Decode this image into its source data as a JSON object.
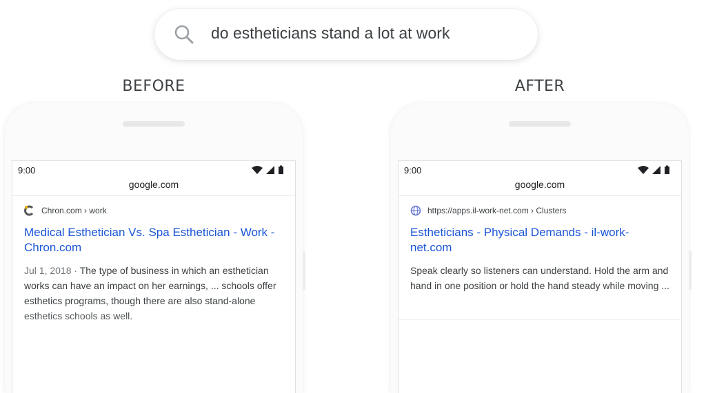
{
  "search": {
    "query": "do estheticians stand a lot at work",
    "icon": "search-icon"
  },
  "before": {
    "caption": "BEFORE",
    "status_time": "9:00",
    "url": "google.com",
    "result": {
      "site": "Chron.com › work",
      "favicon": "chron-favicon-icon",
      "title": "Medical Esthetician Vs. Spa Esthetician - Work - Chron.com",
      "date": "Jul 1, 2018 · ",
      "snippet": "The type of business in which an esthetician works can have an impact on her earnings, ... schools offer esthetics programs, though there are also stand-alone esthetics schools as well."
    }
  },
  "after": {
    "caption": "AFTER",
    "status_time": "9:00",
    "url": "google.com",
    "result": {
      "site": "https://apps.il-work-net.com › Clusters",
      "favicon": "globe-icon",
      "title": "Estheticians - Physical Demands - il-work-net.com",
      "snippet": "Speak clearly so listeners can understand. Hold the arm and hand in one position or hold the hand steady while moving ..."
    }
  },
  "colors": {
    "link": "#1a55d6",
    "text": "#3c4043",
    "muted": "#70757a"
  }
}
